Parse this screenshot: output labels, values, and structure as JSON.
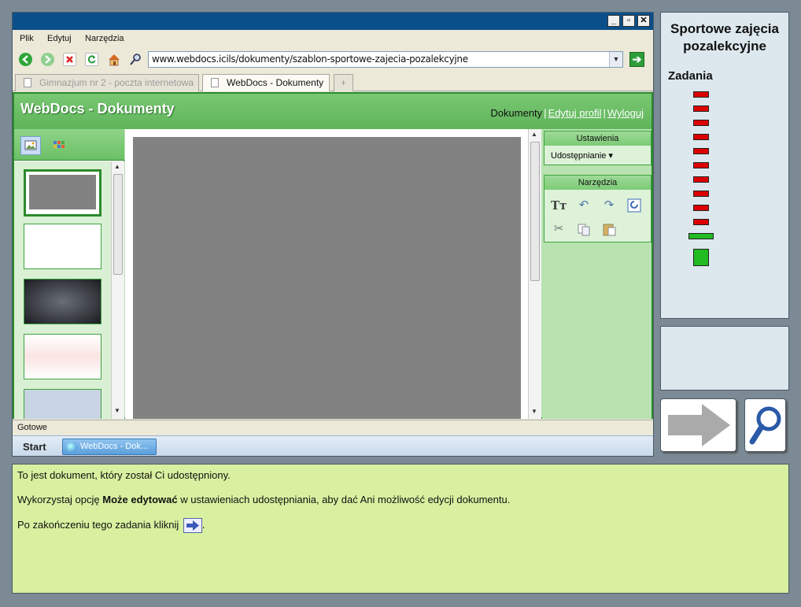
{
  "browser": {
    "menu": [
      "Plik",
      "Edytuj",
      "Narzędzia"
    ],
    "url": "www.webdocs.icils/dokumenty/szablon-sportowe-zajecia-pozalekcyjne",
    "tabs": [
      {
        "label": "Gimnazjum nr 2 - poczta internetowa",
        "active": false
      },
      {
        "label": "WebDocs - Dokumenty",
        "active": true
      },
      {
        "label": "+",
        "active": false
      }
    ],
    "status": "Gotowe"
  },
  "app": {
    "title": "WebDocs - Dokumenty",
    "links": {
      "documents": "Dokumenty",
      "edit_profile": "Edytuj profil",
      "logout": "Wyloguj"
    },
    "settings": {
      "header": "Ustawienia",
      "sharing": "Udostępnianie ▾"
    },
    "tools": {
      "header": "Narzędzia"
    }
  },
  "taskbar": {
    "start": "Start",
    "item": "WebDocs - Dok..."
  },
  "side": {
    "title": "Sportowe zajęcia pozalekcyjne",
    "tasks_label": "Zadania",
    "progress": {
      "total": 12,
      "current": 11,
      "pending_color": "#dd0000",
      "active_color": "#22bb22"
    }
  },
  "instructions": {
    "line1": "To jest dokument, który został Ci udostępniony.",
    "line2_pre": "Wykorzystaj opcję ",
    "line2_bold": "Może edytować",
    "line2_post": " w ustawieniach udostępniania, aby dać Ani możliwość edycji dokumentu.",
    "line3_pre": "Po zakończeniu tego zadania kliknij ",
    "line3_post": "."
  },
  "colors": {
    "app_green": "#5fb55a",
    "instruction_bg": "#d8f0a0",
    "panel_bg": "#dce8ed"
  }
}
